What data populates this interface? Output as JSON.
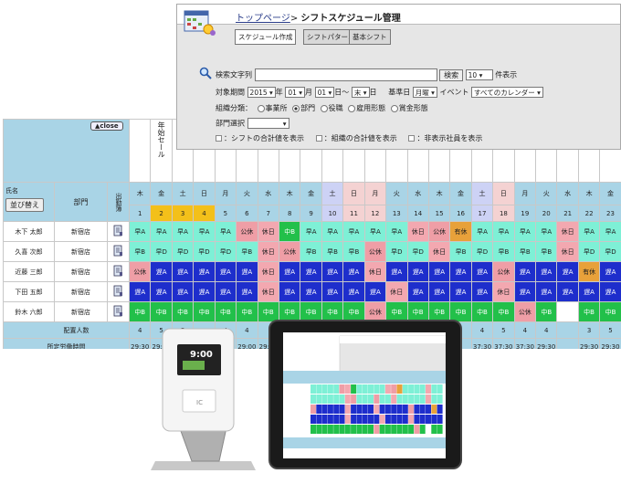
{
  "panel": {
    "breadcrumb": "トップページ",
    "separator": ">",
    "title": "シフトスケジュール管理",
    "tab_schedule": "スケジュール作成",
    "tab_pattern": "シフトパターン",
    "tab_basic": "基本シフト",
    "search_label": "検索文字列",
    "search_button": "検索",
    "per_page_value": "10",
    "per_page_suffix": "件表示",
    "period_label": "対象期間",
    "year_value": "2015",
    "year_unit": "年",
    "month_value": "01",
    "month_unit": "月",
    "day_value": "01",
    "day_unit": "日",
    "tilde": "～",
    "end_value": "末",
    "end_unit": "日",
    "base_day_label": "基準日",
    "base_day_value": "月曜",
    "event_label": "イベント",
    "event_value": "すべてのカレンダー",
    "org_label": "組織分類：",
    "org_options": [
      "事業所",
      "部門",
      "役職",
      "雇用形態",
      "賞金形態"
    ],
    "dept_label": "部門選択",
    "check_shift_total": "：シフトの合計値を表示",
    "check_org_total": "：組織の合計値を表示",
    "check_hide_retired": "：非表示社員を表示"
  },
  "grid": {
    "close_label": "▲close",
    "name_header": "氏名",
    "sort_button": "並び替え",
    "dept_header": "部門",
    "attend_header": "出勤簿",
    "annotations": [
      "",
      "年始セール",
      "ル",
      "ル…",
      "",
      "",
      "",
      "",
      "",
      "",
      "",
      "",
      "",
      "",
      "",
      "",
      "",
      "",
      "",
      "",
      "",
      "",
      ""
    ],
    "days": [
      {
        "dow": "木",
        "date": "1",
        "type": "wk"
      },
      {
        "dow": "金",
        "date": "2",
        "type": "yel"
      },
      {
        "dow": "土",
        "date": "3",
        "type": "yel"
      },
      {
        "dow": "日",
        "date": "4",
        "type": "yel"
      },
      {
        "dow": "月",
        "date": "5",
        "type": "wk"
      },
      {
        "dow": "火",
        "date": "6",
        "type": "wk"
      },
      {
        "dow": "水",
        "date": "7",
        "type": "wk"
      },
      {
        "dow": "木",
        "date": "8",
        "type": "wk"
      },
      {
        "dow": "金",
        "date": "9",
        "type": "wk"
      },
      {
        "dow": "土",
        "date": "10",
        "type": "sat"
      },
      {
        "dow": "日",
        "date": "11",
        "type": "sun"
      },
      {
        "dow": "月",
        "date": "12",
        "type": "sun"
      },
      {
        "dow": "火",
        "date": "13",
        "type": "wk"
      },
      {
        "dow": "水",
        "date": "14",
        "type": "wk"
      },
      {
        "dow": "木",
        "date": "15",
        "type": "wk"
      },
      {
        "dow": "金",
        "date": "16",
        "type": "wk"
      },
      {
        "dow": "土",
        "date": "17",
        "type": "sat"
      },
      {
        "dow": "日",
        "date": "18",
        "type": "sun"
      },
      {
        "dow": "月",
        "date": "19",
        "type": "wk"
      },
      {
        "dow": "火",
        "date": "20",
        "type": "wk"
      },
      {
        "dow": "水",
        "date": "21",
        "type": "wk"
      },
      {
        "dow": "木",
        "date": "22",
        "type": "wk"
      },
      {
        "dow": "金",
        "date": "23",
        "type": "wk"
      }
    ],
    "employees": [
      {
        "name": "木下 太郎",
        "dept": "新宿店",
        "shifts": [
          "早A",
          "早A",
          "早A",
          "早A",
          "早A",
          "公休",
          "休日",
          "中B",
          "早A",
          "早A",
          "早A",
          "早A",
          "早A",
          "休日",
          "公休",
          "有休",
          "早A",
          "早A",
          "早A",
          "早A",
          "休日",
          "早A",
          "早A"
        ]
      },
      {
        "name": "久喜 次郎",
        "dept": "新宿店",
        "shifts": [
          "早B",
          "早D",
          "早D",
          "早D",
          "早D",
          "早B",
          "休日",
          "公休",
          "早B",
          "早B",
          "早B",
          "公休",
          "早D",
          "早D",
          "休日",
          "早B",
          "早D",
          "早B",
          "早B",
          "早B",
          "休日",
          "早D",
          "早D"
        ]
      },
      {
        "name": "近藤 三郎",
        "dept": "新宿店",
        "shifts": [
          "公休",
          "遅A",
          "遅A",
          "遅A",
          "遅A",
          "遅A",
          "休日",
          "遅A",
          "遅A",
          "遅A",
          "遅A",
          "休日",
          "遅A",
          "遅A",
          "遅A",
          "遅A",
          "遅A",
          "公休",
          "遅A",
          "遅A",
          "遅A",
          "有休",
          "遅A"
        ]
      },
      {
        "name": "下田 五郎",
        "dept": "新宿店",
        "shifts": [
          "遅A",
          "遅A",
          "遅A",
          "遅A",
          "遅A",
          "遅A",
          "休日",
          "遅A",
          "遅A",
          "遅A",
          "遅A",
          "遅A",
          "休日",
          "遅A",
          "遅A",
          "遅A",
          "遅A",
          "休日",
          "遅A",
          "遅A",
          "遅A",
          "遅A",
          "遅A"
        ]
      },
      {
        "name": "鈴木 六郎",
        "dept": "新宿店",
        "shifts": [
          "中B",
          "中B",
          "中B",
          "中B",
          "中B",
          "中B",
          "中B",
          "中B",
          "中B",
          "中B",
          "中B",
          "公休",
          "中B",
          "中B",
          "中B",
          "中B",
          "中B",
          "中B",
          "公休",
          "中B",
          "",
          "中B",
          "中B"
        ]
      }
    ],
    "staff_count_label": "配置人数",
    "staff_counts": [
      "4",
      "5",
      "5",
      "",
      "4",
      "4",
      "",
      "",
      "",
      "",
      "",
      "",
      "",
      "",
      "",
      "",
      "4",
      "5",
      "4",
      "4",
      "",
      "3",
      "5"
    ],
    "hours_label": "所定労働時間",
    "hours": [
      "29:30",
      "29:30",
      "29:30",
      "",
      "29:00",
      "29:00",
      "29:00",
      "",
      "",
      "",
      "",
      "",
      "",
      "",
      "",
      "",
      "37:30",
      "37:30",
      "37:30",
      "29:30",
      "",
      "29:30",
      "29:30"
    ]
  },
  "terminal": {
    "time": "9:00",
    "label": "IC"
  },
  "colors": {
    "header_blue": "#a9d4e6",
    "early": "#7ef0d6",
    "late": "#1e2ecc",
    "mid": "#22c04a",
    "holiday": "#ef9ea6",
    "paid_leave": "#e8a13a",
    "highlight": "#f3c01a"
  }
}
